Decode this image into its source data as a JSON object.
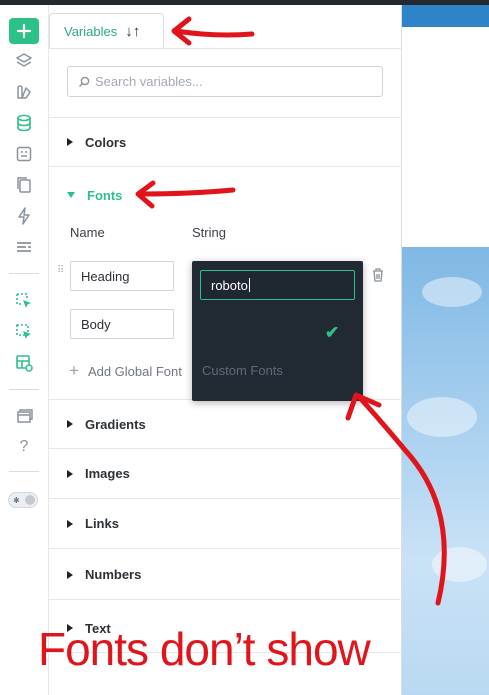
{
  "panel": {
    "tab_label": "Variables",
    "search_placeholder": "Search variables...",
    "sections": {
      "colors": "Colors",
      "fonts": "Fonts",
      "gradients": "Gradients",
      "images": "Images",
      "links": "Links",
      "numbers": "Numbers",
      "text": "Text"
    },
    "fonts": {
      "col_name": "Name",
      "col_type": "String",
      "rows": [
        {
          "name": "Heading"
        },
        {
          "name": "Body"
        }
      ],
      "add_label": "Add Global Font"
    }
  },
  "dropdown": {
    "input_value": "roboto",
    "custom_fonts_label": "Custom Fonts"
  },
  "annotation": {
    "caption": "Fonts don’t show",
    "color": "#e0151c"
  },
  "colors": {
    "accent": "#2ec089",
    "dropdown_bg": "#212a33"
  },
  "icons": [
    "plus-icon",
    "layers-icon",
    "components-icon",
    "database-icon",
    "data-icon",
    "pages-icon",
    "lightning-icon",
    "menu-icon",
    "select-icon",
    "select-multi-icon",
    "preview-icon",
    "window-icon",
    "help-icon"
  ]
}
